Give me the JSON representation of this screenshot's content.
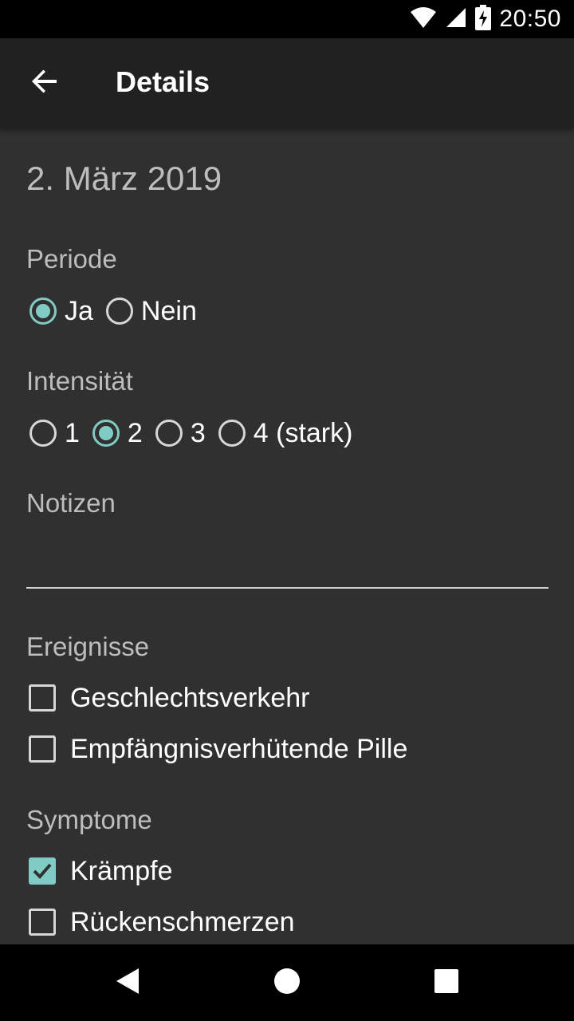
{
  "status_bar": {
    "time": "20:50",
    "icons": [
      "wifi-icon",
      "signal-icon",
      "battery-charging-icon"
    ]
  },
  "toolbar": {
    "back_icon": "arrow-back-icon",
    "title": "Details"
  },
  "details": {
    "date": "2. März 2019",
    "periode": {
      "label": "Periode",
      "options": [
        "Ja",
        "Nein"
      ],
      "selected": "Ja"
    },
    "intensitaet": {
      "label": "Intensität",
      "options": [
        "1",
        "2",
        "3",
        "4 (stark)"
      ],
      "selected": "2"
    },
    "notizen": {
      "label": "Notizen",
      "value": "",
      "placeholder": ""
    },
    "ereignisse": {
      "label": "Ereignisse",
      "items": [
        {
          "label": "Geschlechtsverkehr",
          "checked": false
        },
        {
          "label": "Empfängnisverhütende Pille",
          "checked": false
        }
      ]
    },
    "symptome": {
      "label": "Symptome",
      "items": [
        {
          "label": "Krämpfe",
          "checked": true
        },
        {
          "label": "Rückenschmerzen",
          "checked": false
        }
      ]
    }
  },
  "nav_bar": {
    "icons": [
      "back-triangle-icon",
      "home-circle-icon",
      "recents-square-icon"
    ]
  },
  "colors": {
    "background": "#303030",
    "toolbar": "#212121",
    "accent": "#80cbc4",
    "secondary_text": "#bdbdbd"
  }
}
